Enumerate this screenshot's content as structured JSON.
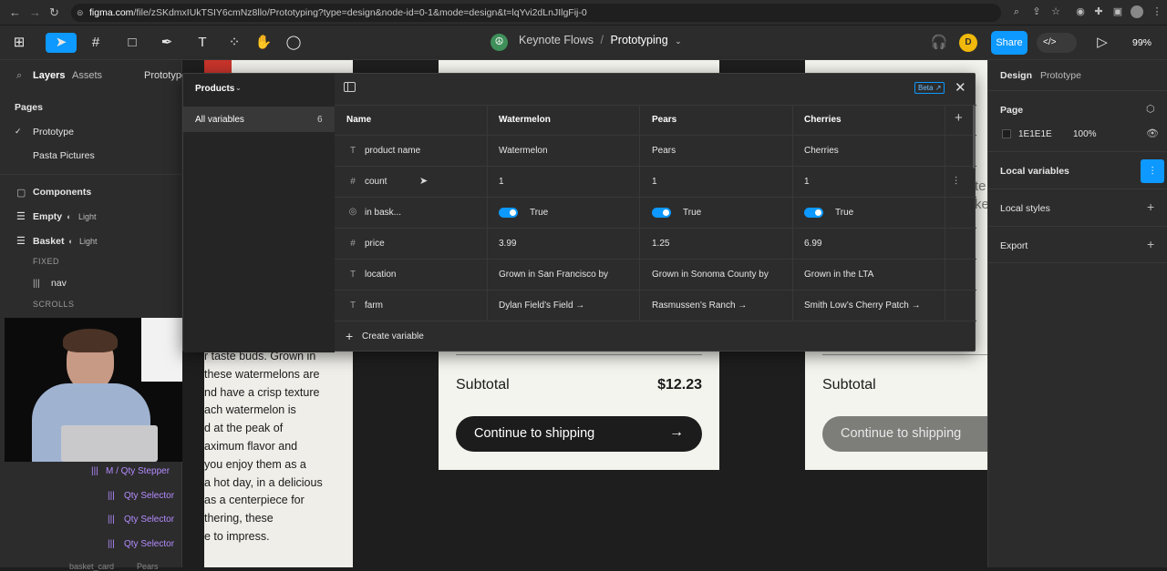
{
  "browser": {
    "url_host": "figma.com",
    "url_path": "/file/zSKdmxIUkTSIY6cmNz8llo/Prototyping?type=design&node-id=0-1&mode=design&t=lqYvi2dLnJIlgFij-0"
  },
  "toolbar": {
    "file_project": "Keynote Flows",
    "file_separator": "/",
    "file_page": "Prototyping",
    "avatar_initial": "D",
    "share_label": "Share",
    "zoom": "99%"
  },
  "left_panel": {
    "tabs": [
      "Layers",
      "Assets",
      "Prototype"
    ],
    "pages_title": "Pages",
    "pages": [
      "Prototype",
      "Pasta Pictures"
    ],
    "components_title": "Components",
    "layers": [
      {
        "name": "Empty",
        "badge": "Light"
      },
      {
        "name": "Basket",
        "badge": "Light"
      }
    ],
    "fixed_label": "FIXED",
    "nav_label": "nav",
    "scrolls_label": "SCROLLS",
    "lower_layers": [
      "M / Qty Stepper",
      "Qty Selector",
      "Qty Selector",
      "Qty Selector"
    ],
    "bottom_layer": "basket_card",
    "bottom_badge": "Pears"
  },
  "modal": {
    "collection": "Products",
    "beta_label": "Beta",
    "sidebar_item": "All variables",
    "sidebar_count": "6",
    "columns": [
      "Name",
      "Watermelon",
      "Pears",
      "Cherries"
    ],
    "rows": [
      {
        "icon": "T",
        "name": "product name",
        "values": [
          "Watermelon",
          "Pears",
          "Cherries"
        ]
      },
      {
        "icon": "#",
        "name": "count",
        "values": [
          "1",
          "1",
          "1"
        ]
      },
      {
        "icon": "◎",
        "name": "in bask...",
        "values": [
          "True",
          "True",
          "True"
        ]
      },
      {
        "icon": "#",
        "name": "price",
        "values": [
          "3.99",
          "1.25",
          "6.99"
        ]
      },
      {
        "icon": "T",
        "name": "location",
        "values": [
          "Grown in San Francisco by",
          "Grown in Sonoma County by",
          "Grown in the LTA"
        ]
      },
      {
        "icon": "T",
        "name": "farm",
        "values": [
          "Dylan Field’s Field →",
          "Rasmussen’s Ranch →",
          "Smith Low’s Cherry Patch →"
        ]
      }
    ],
    "create_variable": "Create variable"
  },
  "canvas": {
    "body_text": [
      "r taste buds. Grown in",
      "these watermelons are",
      "nd have a crisp texture",
      "ach watermelon is",
      "d at the peak of",
      "aximum flavor and",
      "you enjoy them as a",
      "a hot day, in a delicious",
      "as a centerpiece for",
      "thering, these",
      "e to impress."
    ],
    "subtotal_label": "Subtotal",
    "subtotal_value": "$12.23",
    "continue_label": "Continue to shipping",
    "subtotal_label_2": "Subtotal",
    "continue_label_2": "Continue to shipping",
    "clip_text": [
      "te",
      "ke"
    ]
  },
  "right_panel": {
    "tabs": [
      "Design",
      "Prototype"
    ],
    "page_title": "Page",
    "page_color": "1E1E1E",
    "page_opacity": "100%",
    "local_variables": "Local variables",
    "local_styles": "Local styles",
    "export": "Export"
  },
  "colors": {
    "accent": "#0d99ff",
    "canvas": "#1e1e1e",
    "panel": "#2c2c2c"
  }
}
